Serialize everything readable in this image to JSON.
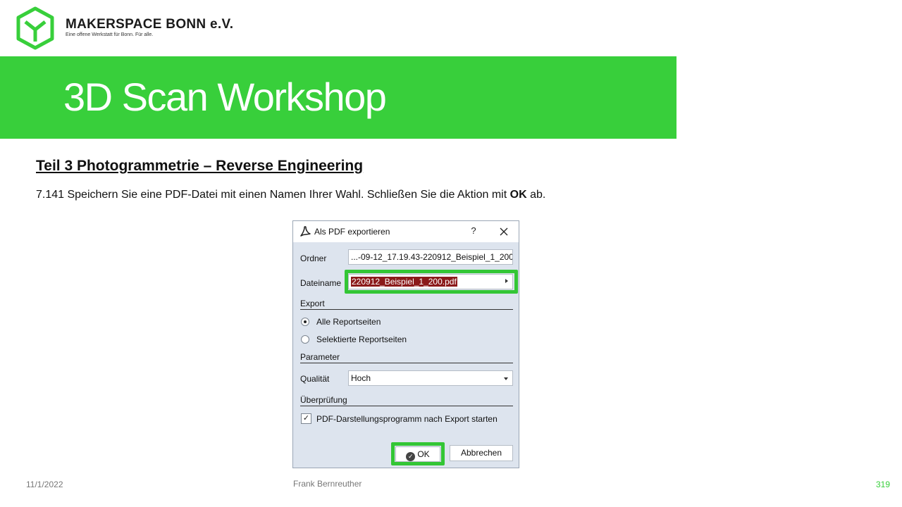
{
  "brand": {
    "name": "MAKERSPACE BONN e.V.",
    "tagline": "Eine offene Werkstatt für Bonn. Für alle.",
    "color": "#38cf3b"
  },
  "banner": {
    "title": "3D Scan Workshop"
  },
  "section": {
    "heading": "Teil 3  Photogrammetrie  – Reverse Engineering"
  },
  "instruction": {
    "before": "7.141 Speichern Sie eine PDF-Datei mit einen Namen Ihrer Wahl. Schließen Sie die Aktion mit ",
    "bold": "OK",
    "after": " ab."
  },
  "dialog": {
    "title": "Als PDF exportieren",
    "help_label": "?",
    "icon": "pdf-icon",
    "folder_label": "Ordner",
    "folder_value": "...-09-12_17.19.43-220912_Beispiel_1_200",
    "filename_label": "Dateiname",
    "filename_value": "220912_Beispiel_1_200.pdf",
    "export_group": "Export",
    "radio_all": "Alle Reportseiten",
    "radio_selected": "Selektierte Reportseiten",
    "parameter_group": "Parameter",
    "quality_label": "Qualität",
    "quality_value": "Hoch",
    "check_group": "Überprüfung",
    "checkbox_label": "PDF-Darstellungsprogramm nach Export starten",
    "ok_label": "OK",
    "cancel_label": "Abbrechen",
    "highlight_color": "#33c635"
  },
  "footer": {
    "date": "11/1/2022",
    "author": "Frank Bernreuther",
    "page": "319"
  }
}
